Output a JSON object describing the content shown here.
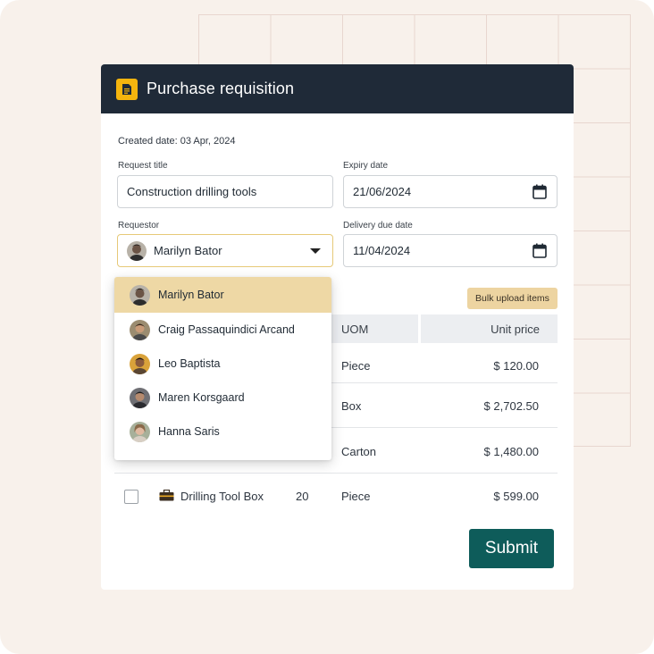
{
  "header": {
    "title": "Purchase requisition",
    "icon": "document-icon",
    "accent": "#f5b50e",
    "bg": "#1f2a38"
  },
  "created": "Created date: 03 Apr, 2024",
  "fields": {
    "request_title": {
      "label": "Request title",
      "value": "Construction drilling tools"
    },
    "expiry_date": {
      "label": "Expiry date",
      "value": "21/06/2024"
    },
    "requestor": {
      "label": "Requestor",
      "value": "Marilyn Bator"
    },
    "delivery_due_date": {
      "label": "Delivery due date",
      "value": "11/04/2024"
    }
  },
  "dropdown": {
    "options": [
      {
        "name": "Marilyn Bator",
        "selected": true
      },
      {
        "name": "Craig Passaquindici Arcand",
        "selected": false
      },
      {
        "name": "Leo Baptista",
        "selected": false
      },
      {
        "name": "Maren Korsgaard",
        "selected": false
      },
      {
        "name": "Hanna Saris",
        "selected": false
      }
    ]
  },
  "bulk_upload_label": "Bulk upload items",
  "table": {
    "columns": {
      "uom": "UOM",
      "unit_price": "Unit price"
    },
    "rows": [
      {
        "uom": "Piece",
        "price": "$ 120.00"
      },
      {
        "uom": "Box",
        "price": "$ 2,702.50"
      },
      {
        "uom": "Carton",
        "price": "$ 1,480.00"
      },
      {
        "item": "Drilling Tool Box",
        "qty": "20",
        "uom": "Piece",
        "price": "$ 599.00",
        "icon": "toolbox-icon"
      }
    ]
  },
  "submit_label": "Submit",
  "colors": {
    "submit": "#0e5c5a",
    "selected_option": "#eed8a5",
    "bulk_button": "#edd4a1",
    "page_bg": "#f8f1eb"
  }
}
